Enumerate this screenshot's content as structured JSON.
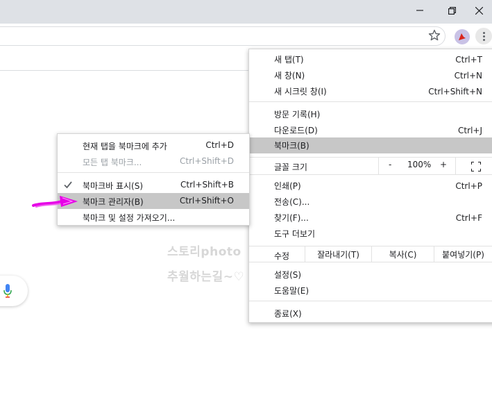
{
  "window": {
    "minimize_icon": "minimize-icon",
    "restore_icon": "restore-icon",
    "close_icon": "close-icon"
  },
  "toolbar": {
    "bookmark_star_icon": "star-icon",
    "extension_icon": "extension-icon",
    "menu_icon": "kebab-menu-icon"
  },
  "watermark": {
    "line1": "스토리photo",
    "line2": "추월하는길~♡"
  },
  "main_menu": {
    "items_top": [
      {
        "label": "새 탭(T)",
        "shortcut": "Ctrl+T"
      },
      {
        "label": "새 창(N)",
        "shortcut": "Ctrl+N"
      },
      {
        "label": "새 시크릿 창(I)",
        "shortcut": "Ctrl+Shift+N"
      }
    ],
    "items_mid": [
      {
        "label": "방문 기록(H)",
        "shortcut": ""
      },
      {
        "label": "다운로드(D)",
        "shortcut": "Ctrl+J"
      },
      {
        "label": "북마크(B)",
        "shortcut": ""
      }
    ],
    "zoom": {
      "label": "글꼴 크기",
      "minus": "-",
      "value": "100%",
      "plus": "+"
    },
    "items_tools": [
      {
        "label": "인쇄(P)",
        "shortcut": "Ctrl+P"
      },
      {
        "label": "전송(C)...",
        "shortcut": ""
      },
      {
        "label": "찾기(F)...",
        "shortcut": "Ctrl+F"
      },
      {
        "label": "도구 더보기",
        "shortcut": ""
      }
    ],
    "edit": {
      "label": "수정",
      "cut": "잘라내기(T)",
      "copy": "복사(C)",
      "paste": "붙여넣기(P)"
    },
    "items_bottom": [
      {
        "label": "설정(S)"
      },
      {
        "label": "도움말(E)"
      }
    ],
    "exit": {
      "label": "종료(X)"
    }
  },
  "bookmark_submenu": {
    "items": [
      {
        "label": "현재 탭을 북마크에 추가",
        "shortcut": "Ctrl+D"
      },
      {
        "label": "모든 탭 북마크...",
        "shortcut": "Ctrl+Shift+D"
      },
      {
        "label": "북마크바 표시(S)",
        "shortcut": "Ctrl+Shift+B"
      },
      {
        "label": "북마크 관리자(B)",
        "shortcut": "Ctrl+Shift+O"
      },
      {
        "label": "북마크 및 설정 가져오기...",
        "shortcut": ""
      }
    ]
  },
  "colors": {
    "highlight": "#c7c7c7",
    "pointer": "#e600e6",
    "titlebar": "#dee1e6"
  }
}
